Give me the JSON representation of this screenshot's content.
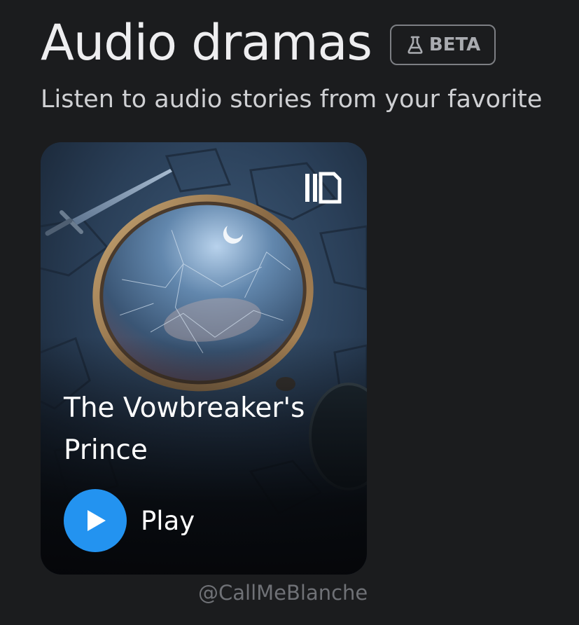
{
  "header": {
    "title": "Audio dramas",
    "badge_label": "BETA",
    "badge_icon": "flask-icon",
    "subtitle": "Listen to audio stories from your favorite"
  },
  "card": {
    "title": "The Vowbreaker's Prince",
    "brand_icon": "book-stack-icon",
    "play_label": "Play",
    "play_icon": "play-icon",
    "play_color": "#2393f0"
  },
  "watermark": "@CallMeBlanche"
}
